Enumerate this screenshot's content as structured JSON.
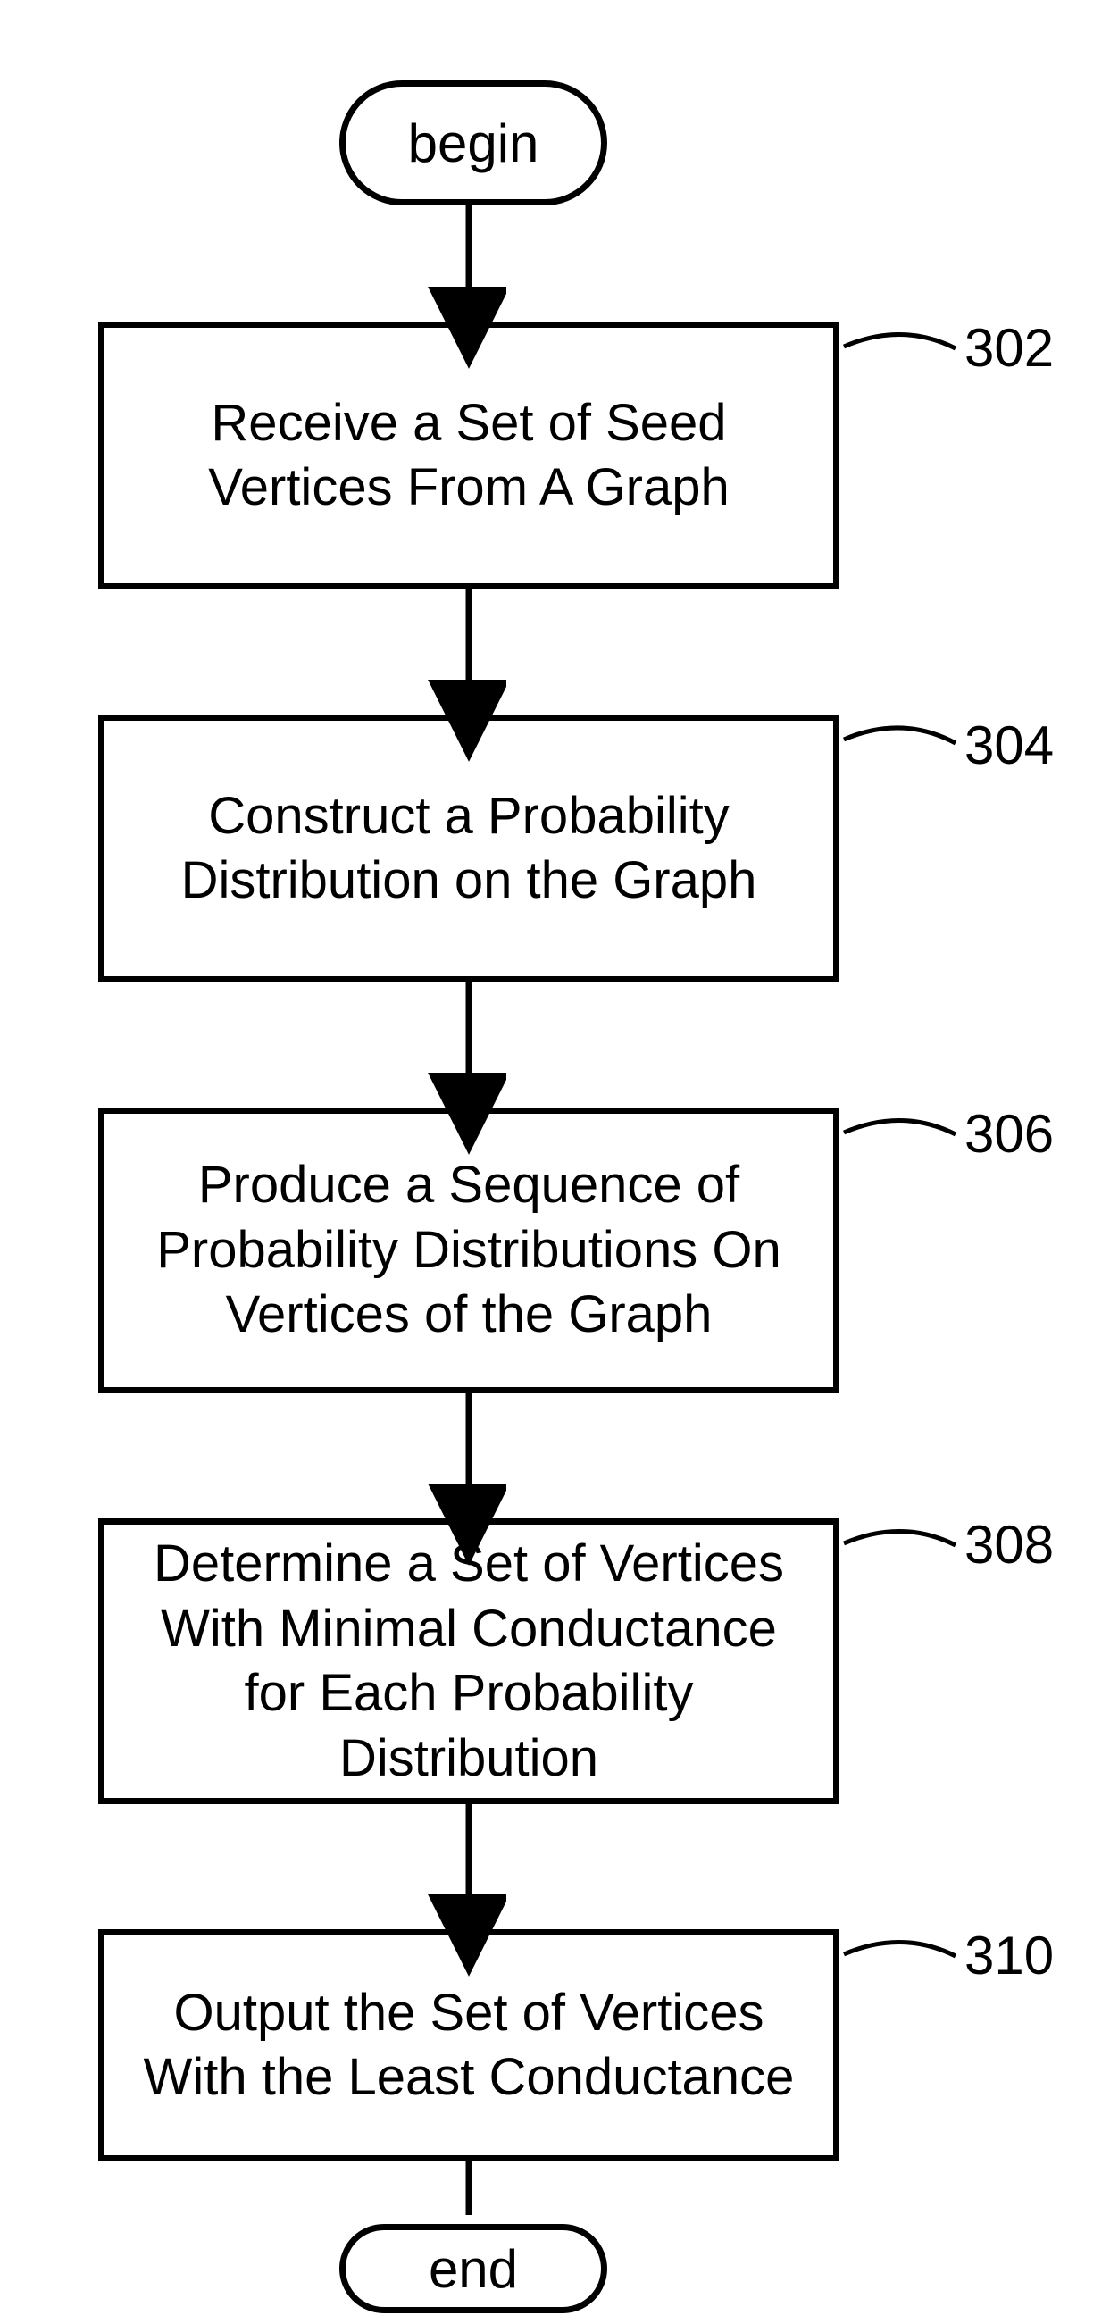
{
  "flow": {
    "begin": "begin",
    "end": "end",
    "steps": {
      "s1": "Receive a Set of Seed Vertices From A Graph",
      "s2": "Construct a Probability Distribution on the Graph",
      "s3": "Produce a Sequence of Probability Distributions On Vertices of the Graph",
      "s4": "Determine a Set of Vertices With Minimal Conductance for Each Probability Distribution",
      "s5": "Output the Set of Vertices With the Least Conductance"
    },
    "refs": {
      "s1": "302",
      "s2": "304",
      "s3": "306",
      "s4": "308",
      "s5": "310"
    }
  }
}
